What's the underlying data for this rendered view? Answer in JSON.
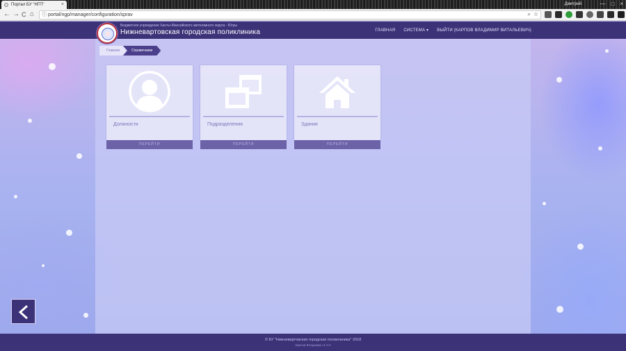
{
  "browser": {
    "tab_title": "Портал БУ \"НГП\"",
    "tab_close": "×",
    "profile": "Дмитрий",
    "address_url": "portal/ngp/manager/configuration/sprav",
    "back": "←",
    "forward": "→",
    "reload": "C",
    "home": "⌂",
    "info": "ⓘ",
    "zoom": "⌕",
    "star": "☆",
    "minimize": "—",
    "maximize": "□",
    "close": "×",
    "menu": "⋮"
  },
  "header": {
    "org_subtitle": "Бюджетное учреждение Ханты-Мансийского автономного округа - Югры",
    "org_title": "Нижневартовская городская поликлиника",
    "nav": {
      "home": "ГЛАВНАЯ",
      "system": "СИСТЕМА ▾",
      "logout": "ВЫЙТИ (КАРПОВ ВЛАДИМИР ВИТАЛЬЕВИЧ)"
    }
  },
  "breadcrumb": {
    "home": "Главная",
    "current": "Справочники"
  },
  "cards": [
    {
      "icon": "user-icon",
      "label": "Должности",
      "button": "ПЕРЕЙТИ"
    },
    {
      "icon": "windows-icon",
      "label": "Подразделения",
      "button": "ПЕРЕЙТИ"
    },
    {
      "icon": "home-icon",
      "label": "Здания",
      "button": "ПЕРЕЙТИ"
    }
  ],
  "footer": {
    "copyright": "© БУ \"Нижневартовская городская поликлиника\" 2018",
    "author": "Карпов Владимир   v1.0.0"
  },
  "colors": {
    "header_bg": "#3b3278",
    "card_button": "#6c62a8",
    "breadcrumb_active": "#4b3f8c"
  }
}
